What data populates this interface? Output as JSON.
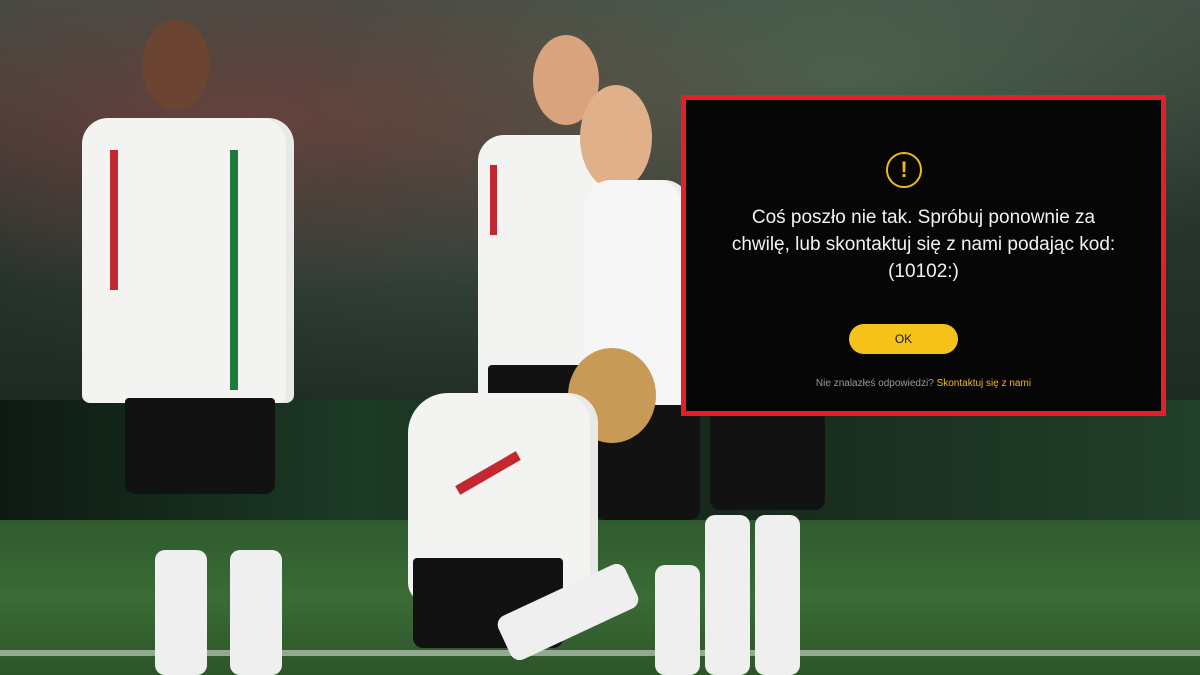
{
  "dialog": {
    "icon": "warning-icon",
    "message": "Coś poszło nie tak. Spróbuj ponownie za chwilę, lub skontaktuj się z nami podając kod: (10102:)",
    "ok_label": "OK",
    "footer_question": "Nie znalazłeś odpowiedzi?",
    "footer_link": "Skontaktuj się z nami",
    "border_color": "#e3202a",
    "accent_color": "#f5c21a"
  }
}
